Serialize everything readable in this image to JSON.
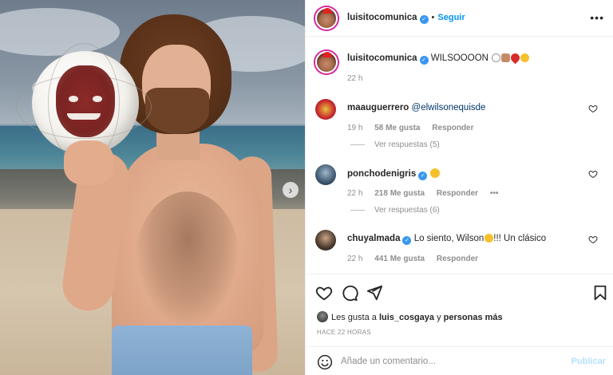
{
  "post": {
    "author": "luisitocomunica",
    "follow_label": "Seguir",
    "more_label": "•••",
    "caption": {
      "author": "luisitocomunica",
      "text": "WILSOOOON",
      "time": "22 h"
    },
    "next_label": "›"
  },
  "comments": [
    {
      "user": "maauguerrero",
      "text": "@elwilsonequisde",
      "time": "19 h",
      "likes": "58 Me gusta",
      "reply_label": "Responder",
      "replies_label": "Ver respuestas (5)"
    },
    {
      "user": "ponchodenigris",
      "text": "",
      "time": "22 h",
      "likes": "218 Me gusta",
      "reply_label": "Responder",
      "more_label": "•••",
      "replies_label": "Ver respuestas (6)"
    },
    {
      "user": "chuyalmada",
      "text_before": "Lo siento, Wilson",
      "text_after": "!!! Un clásico",
      "time": "22 h",
      "likes": "441 Me gusta",
      "reply_label": "Responder"
    }
  ],
  "likes_line": {
    "prefix": "Les gusta a ",
    "user": "luis_cosgaya",
    "middle": " y ",
    "others": "personas más"
  },
  "posted_ago": "HACE 22 HORAS",
  "add_comment": {
    "placeholder": "Añade un comentario...",
    "publish_label": "Publicar"
  },
  "colors": {
    "accent": "#0095f6",
    "verified": "#3897f0",
    "publish_disabled": "#b2dffc",
    "secondary_text": "#8e8e8e"
  },
  "icons": [
    "verified-badge-icon",
    "more-options-icon",
    "heart-icon",
    "comment-icon",
    "share-icon",
    "bookmark-icon",
    "emoji-icon",
    "next-arrow-icon"
  ]
}
